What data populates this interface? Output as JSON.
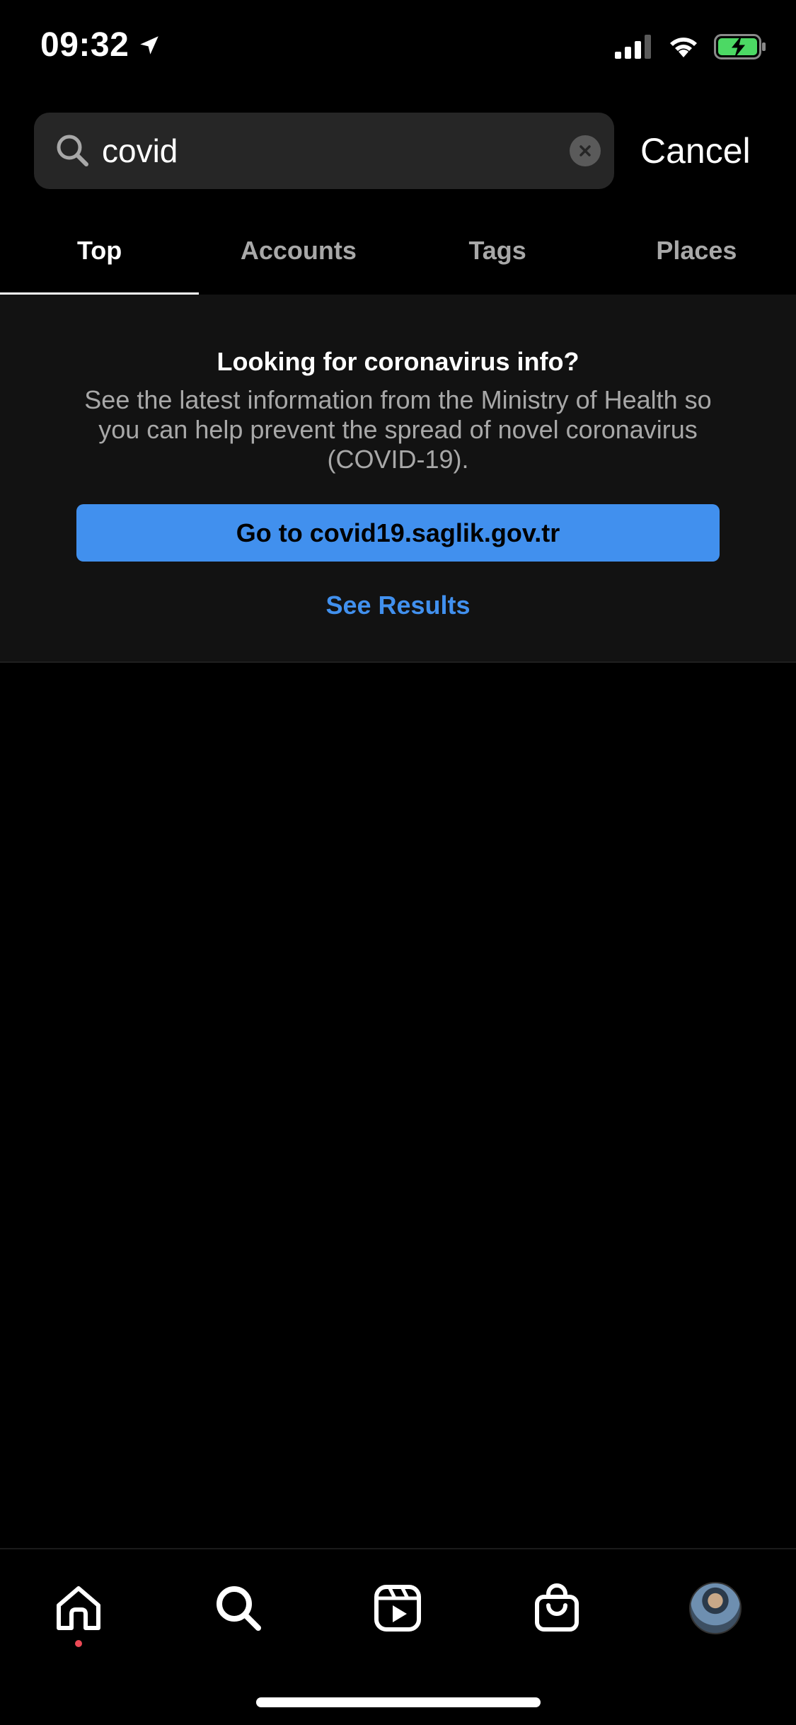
{
  "status_bar": {
    "time": "09:32",
    "icons": [
      "location-arrow-icon",
      "cellular-signal-icon",
      "wifi-icon",
      "battery-charging-icon"
    ],
    "battery_color": "#4cd964"
  },
  "search": {
    "value": "covid",
    "placeholder": "Search",
    "cancel_label": "Cancel"
  },
  "tabs": [
    {
      "label": "Top",
      "active": true
    },
    {
      "label": "Accounts",
      "active": false
    },
    {
      "label": "Tags",
      "active": false
    },
    {
      "label": "Places",
      "active": false
    }
  ],
  "info_card": {
    "title": "Looking for coronavirus info?",
    "body": "See the latest information from the Ministry of Health so you can help prevent the spread of novel coronavirus (COVID-19).",
    "button_label": "Go to covid19.saglik.gov.tr",
    "see_results_label": "See Results"
  },
  "colors": {
    "background": "#000000",
    "card_background": "#121212",
    "search_background": "#262626",
    "accent_blue": "#4190ee",
    "notification_dot": "#ed4956"
  },
  "bottom_nav": {
    "items": [
      "home-icon",
      "search-icon",
      "reels-icon",
      "shop-bag-icon",
      "profile-avatar"
    ]
  }
}
